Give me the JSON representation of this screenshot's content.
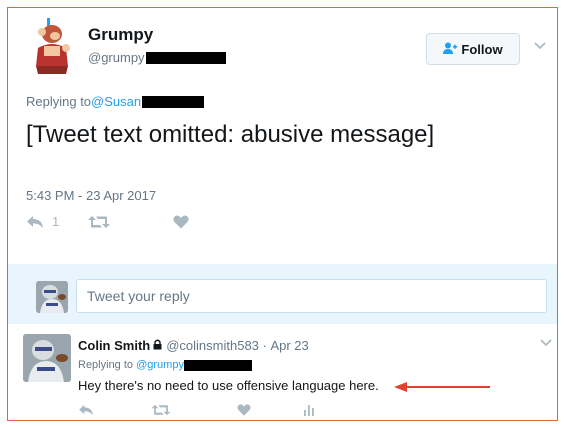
{
  "tweet": {
    "name": "Grumpy",
    "handle": "@grumpy",
    "follow_label": "Follow",
    "replying_prefix": "Replying to ",
    "replying_to": "@Susan",
    "body": "[Tweet text omitted: abusive message]",
    "timestamp": "5:43 PM - 23 Apr 2017",
    "reply_count": "1"
  },
  "composer": {
    "placeholder": "Tweet your reply"
  },
  "reply": {
    "name": "Colin Smith",
    "handle": "@colinsmith583",
    "date_sep": " · ",
    "date": "Apr 23",
    "replying_prefix": "Replying to ",
    "replying_to": "@grumpy",
    "text": "Hey there's no need to use offensive language here."
  },
  "colors": {
    "accent": "#1da1f2",
    "frame_border": "#e0643f",
    "annotation_arrow": "#e0432b",
    "composer_bg": "#e8f5fd"
  },
  "icons": {
    "follow": "user-plus-icon",
    "reply": "reply-icon",
    "retweet": "retweet-icon",
    "like": "heart-icon",
    "analytics": "analytics-icon",
    "lock": "lock-icon",
    "caret": "chevron-down-icon"
  }
}
